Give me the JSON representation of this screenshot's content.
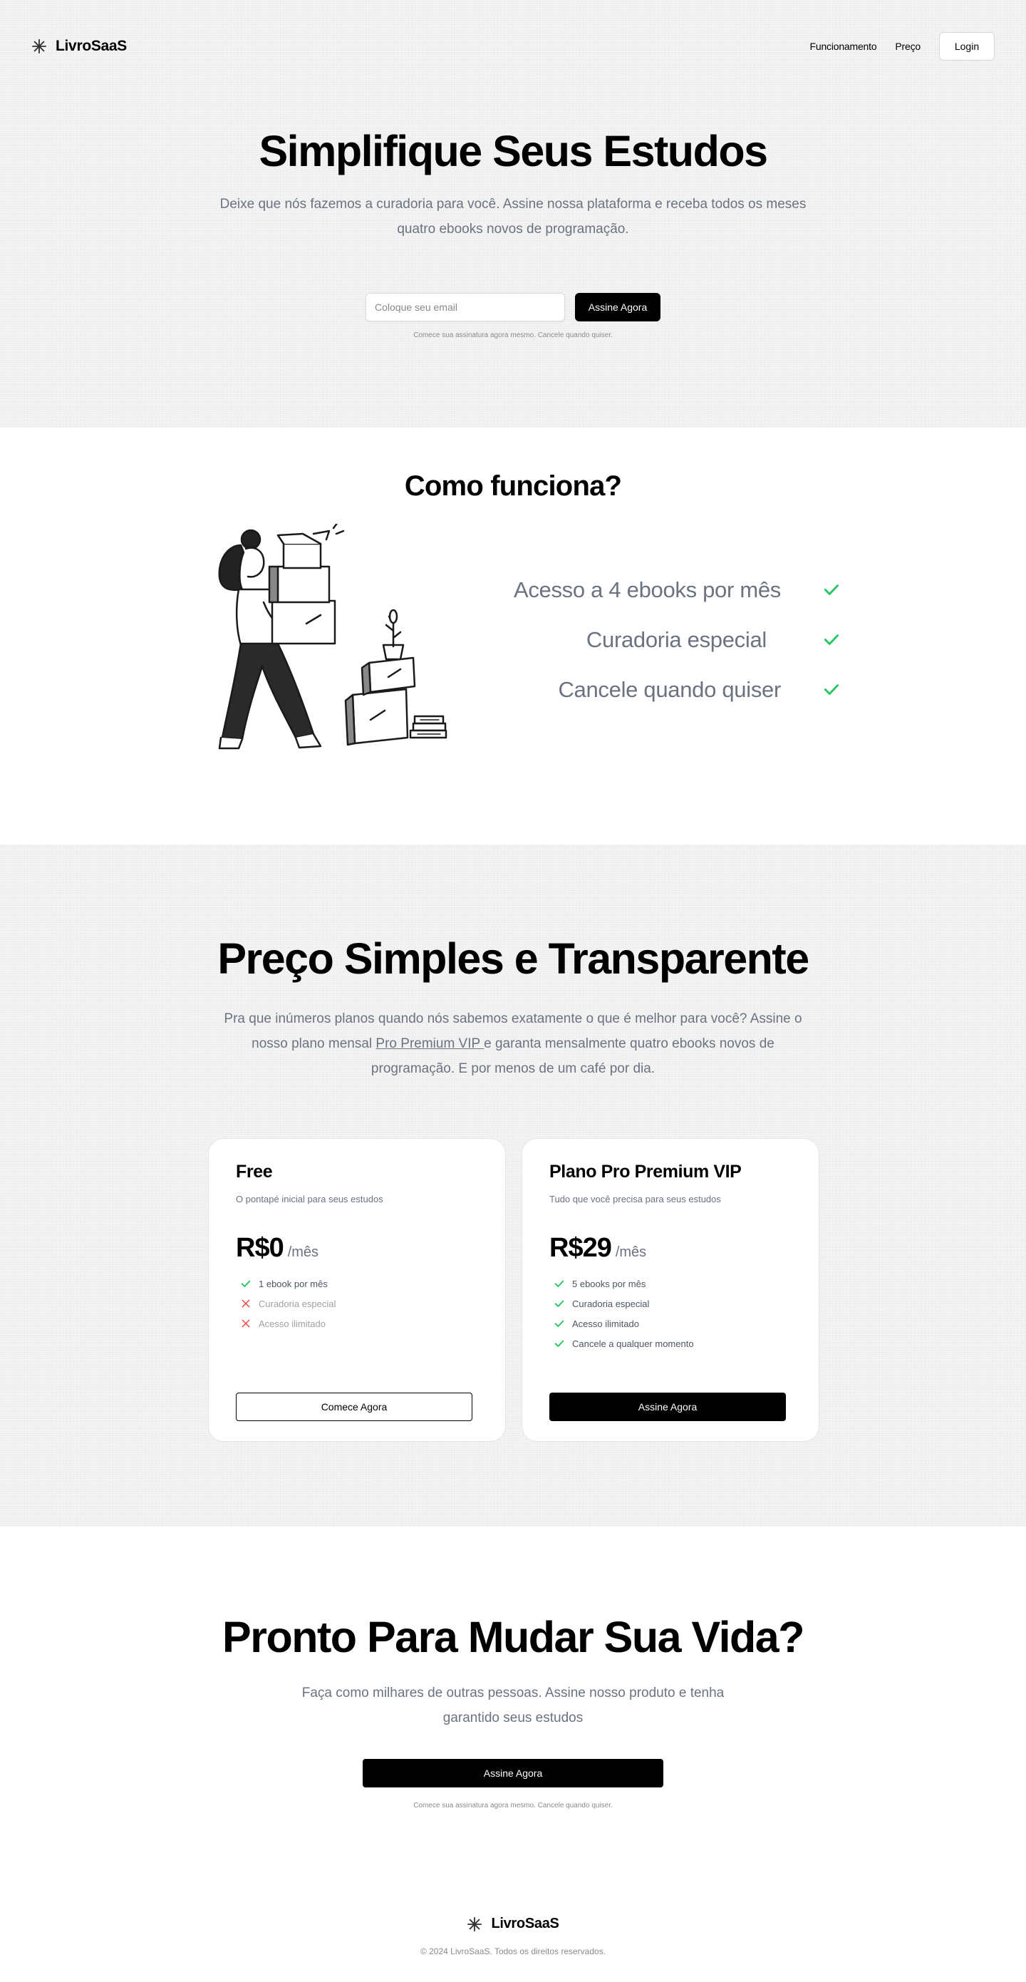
{
  "brand": {
    "name": "LivroSaaS",
    "icon": "sparkle-icon"
  },
  "nav": {
    "links": [
      "Funcionamento",
      "Preço"
    ],
    "login_label": "Login"
  },
  "hero": {
    "title": "Simplifique Seus Estudos",
    "subtitle": "Deixe que nós fazemos a curadoria para você. Assine nossa plataforma e receba todos os meses quatro ebooks novos de programação.",
    "email_placeholder": "Coloque seu email",
    "button_label": "Assine Agora",
    "fine_print": "Comece sua assinatura agora mesmo. Cancele quando quiser."
  },
  "how": {
    "title": "Como funciona?",
    "features": [
      {
        "text": "Acesso a 4 ebooks por mês",
        "icon": "check-icon"
      },
      {
        "text": "Curadoria especial",
        "icon": "check-icon"
      },
      {
        "text": "Cancele quando quiser",
        "icon": "check-icon"
      }
    ]
  },
  "pricing": {
    "title": "Preço Simples e Transparente",
    "subtitle_before": "Pra que inúmeros planos quando nós sabemos exatamente o que é melhor para você? Assine o nosso plano mensal ",
    "subtitle_link": "Pro Premium VIP ",
    "subtitle_after": "e garanta mensalmente quatro ebooks novos de programação. E por menos de um café por dia.",
    "plans": [
      {
        "name": "Free",
        "description": "O pontapé inicial para seus estudos",
        "price": "R$0",
        "period": "/mês",
        "features": [
          {
            "text": "1 ebook por mês",
            "included": true
          },
          {
            "text": "Curadoria especial",
            "included": false
          },
          {
            "text": "Acesso ilimitado",
            "included": false
          }
        ],
        "button_label": "Comece Agora"
      },
      {
        "name": "Plano Pro Premium VIP",
        "description": "Tudo que você precisa para seus estudos",
        "price": "R$29",
        "period": "/mês",
        "features": [
          {
            "text": "5 ebooks por mês",
            "included": true
          },
          {
            "text": "Curadoria especial",
            "included": true
          },
          {
            "text": "Acesso ilimitado",
            "included": true
          },
          {
            "text": "Cancele a qualquer momento",
            "included": true
          }
        ],
        "button_label": "Assine Agora"
      }
    ]
  },
  "cta": {
    "title": "Pronto Para Mudar Sua Vida?",
    "subtitle": "Faça como milhares de outras pessoas. Assine nosso produto e tenha garantido seus estudos",
    "button_label": "Assine Agora",
    "fine_print": "Comece sua assinatura agora mesmo. Cancele quando quiser."
  },
  "footer": {
    "copyright": "© 2024 LivroSaaS. Todos os direitos reservados."
  },
  "colors": {
    "accent_green": "#22c55e",
    "cross_red": "#ef4444",
    "muted_text": "#6b7280",
    "primary_black": "#000000"
  }
}
